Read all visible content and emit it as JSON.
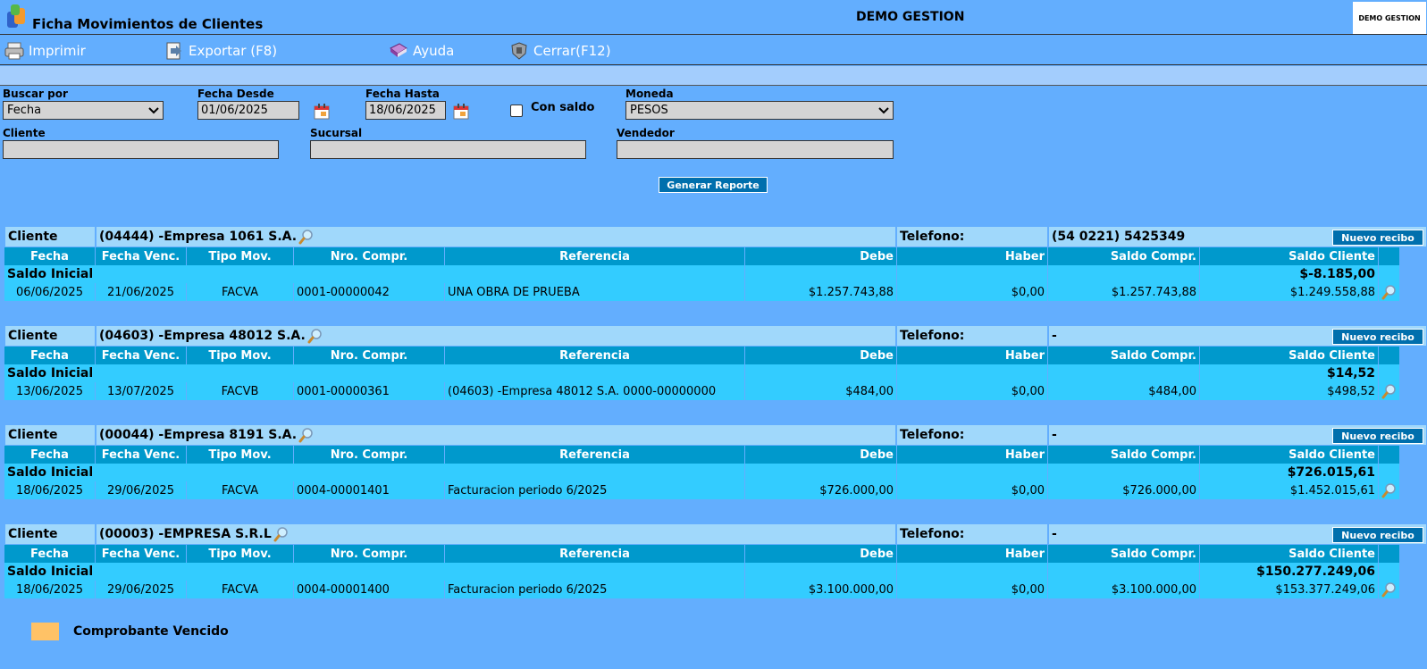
{
  "header": {
    "title": "Ficha Movimientos de Clientes",
    "company": "DEMO GESTION",
    "logo_text": "DEMO GESTION"
  },
  "toolbar": {
    "print": "Imprimir",
    "export": "Exportar (F8)",
    "help": "Ayuda",
    "close": "Cerrar(F12)"
  },
  "filters": {
    "search_by_label": "Buscar por",
    "search_by_value": "Fecha",
    "date_from_label": "Fecha Desde",
    "date_from": "01/06/2025",
    "date_to_label": "Fecha Hasta",
    "date_to": "18/06/2025",
    "balance_label": "Con saldo",
    "currency_label": "Moneda",
    "currency_value": "PESOS",
    "client_label": "Cliente",
    "branch_label": "Sucursal",
    "seller_label": "Vendedor",
    "generate": "Generar Reporte"
  },
  "columns": [
    "Fecha",
    "Fecha Venc.",
    "Tipo Mov.",
    "Nro. Compr.",
    "Referencia",
    "Debe",
    "Haber",
    "Saldo Compr.",
    "Saldo Cliente"
  ],
  "labels": {
    "client": "Cliente",
    "phone": "Telefono:",
    "new_receipt": "Nuevo recibo",
    "initial_balance": "Saldo Inicial"
  },
  "clients": [
    {
      "name": "(04444) -Empresa 1061 S.A.",
      "phone": "(54 0221) 5425349",
      "initial": "$-8.185,00",
      "row": {
        "date": "06/06/2025",
        "due": "21/06/2025",
        "type": "FACVA",
        "number": "0001-00000042",
        "reference": "UNA OBRA DE PRUEBA",
        "debit": "$1.257.743,88",
        "credit": "$0,00",
        "doc_balance": "$1.257.743,88",
        "client_balance": "$1.249.558,88"
      }
    },
    {
      "name": "(04603) -Empresa 48012 S.A.",
      "phone": "-",
      "initial": "$14,52",
      "row": {
        "date": "13/06/2025",
        "due": "13/07/2025",
        "type": "FACVB",
        "number": "0001-00000361",
        "reference": "(04603) -Empresa 48012 S.A. 0000-00000000",
        "debit": "$484,00",
        "credit": "$0,00",
        "doc_balance": "$484,00",
        "client_balance": "$498,52"
      }
    },
    {
      "name": "(00044) -Empresa 8191 S.A.",
      "phone": "-",
      "initial": "$726.015,61",
      "row": {
        "date": "18/06/2025",
        "due": "29/06/2025",
        "type": "FACVA",
        "number": "0004-00001401",
        "reference": "Facturacion periodo 6/2025",
        "debit": "$726.000,00",
        "credit": "$0,00",
        "doc_balance": "$726.000,00",
        "client_balance": "$1.452.015,61"
      }
    },
    {
      "name": "(00003) -EMPRESA S.R.L",
      "phone": "-",
      "initial": "$150.277.249,06",
      "row": {
        "date": "18/06/2025",
        "due": "29/06/2025",
        "type": "FACVA",
        "number": "0004-00001400",
        "reference": "Facturacion periodo 6/2025",
        "debit": "$3.100.000,00",
        "credit": "$0,00",
        "doc_balance": "$3.100.000,00",
        "client_balance": "$153.377.249,06"
      }
    }
  ],
  "legend": {
    "label": "Comprobante Vencido",
    "color": "#ffc266"
  }
}
